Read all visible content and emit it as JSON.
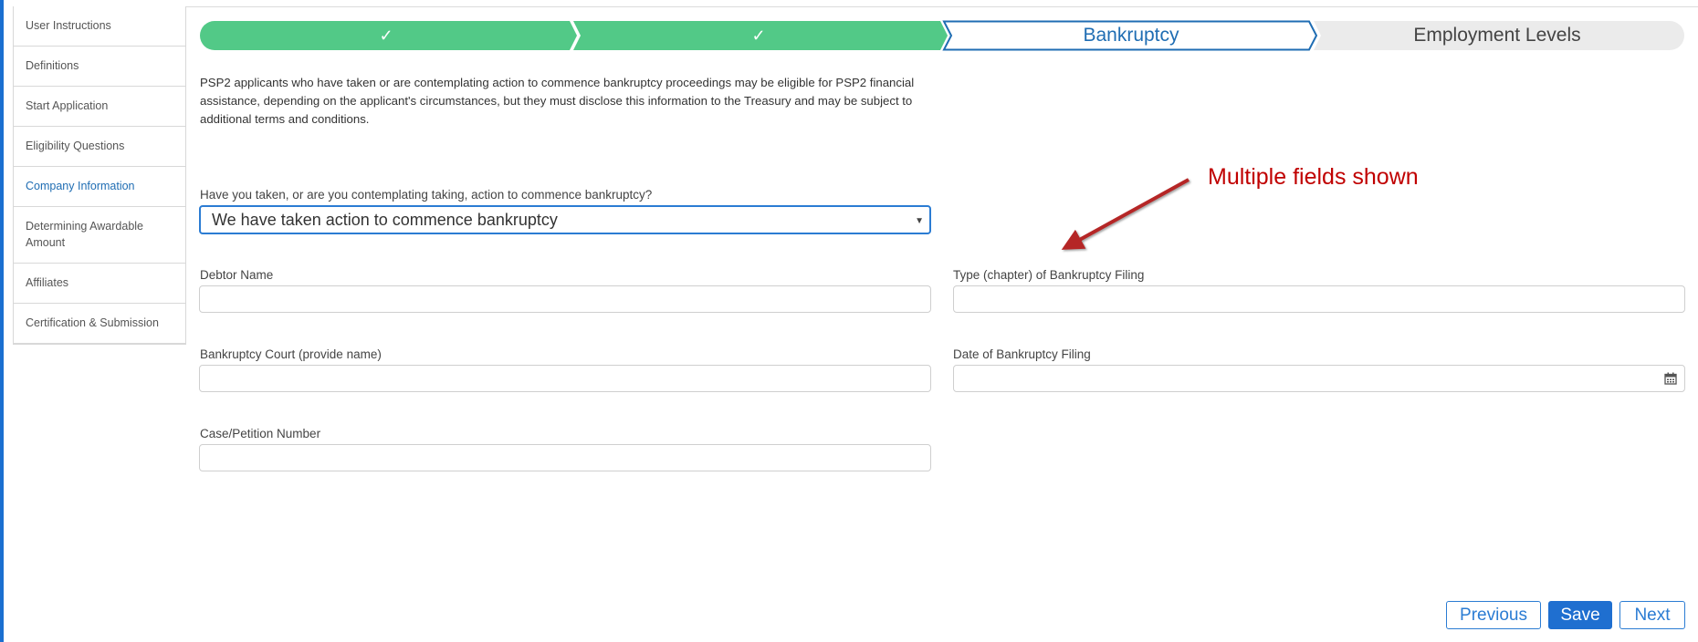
{
  "sidebar": {
    "items": [
      {
        "label": "User Instructions"
      },
      {
        "label": "Definitions"
      },
      {
        "label": "Start Application"
      },
      {
        "label": "Eligibility Questions"
      },
      {
        "label": "Company Information"
      },
      {
        "label": "Determining Awardable Amount"
      },
      {
        "label": "Affiliates"
      },
      {
        "label": "Certification & Submission"
      }
    ]
  },
  "steps": {
    "step3": "Bankruptcy",
    "step4": "Employment Levels",
    "check": "✓"
  },
  "colors": {
    "step_complete": "#52c987",
    "step_current_border": "#1f6db3",
    "step_pending": "#ebebeb",
    "accent": "#1f6fd0",
    "annotation": "#c00000"
  },
  "description": "PSP2 applicants who have taken or are contemplating action to commence bankruptcy proceedings may be eligible for PSP2 financial assistance, depending on the applicant's circumstances, but they must disclose this information to the Treasury and may be subject to additional terms and conditions.",
  "question": {
    "label": "Have you taken, or are you contemplating taking, action to commence bankruptcy?",
    "value": "We have taken action to commence bankruptcy"
  },
  "fields": {
    "debtor_name": {
      "label": "Debtor Name",
      "value": ""
    },
    "chapter_type": {
      "label": "Type (chapter) of Bankruptcy Filing",
      "value": ""
    },
    "court": {
      "label": "Bankruptcy Court (provide name)",
      "value": ""
    },
    "filing_date": {
      "label": "Date of Bankruptcy Filing",
      "value": ""
    },
    "case_number": {
      "label": "Case/Petition Number",
      "value": ""
    }
  },
  "annotation": {
    "text": "Multiple fields shown"
  },
  "buttons": {
    "previous": "Previous",
    "save": "Save",
    "next": "Next"
  }
}
